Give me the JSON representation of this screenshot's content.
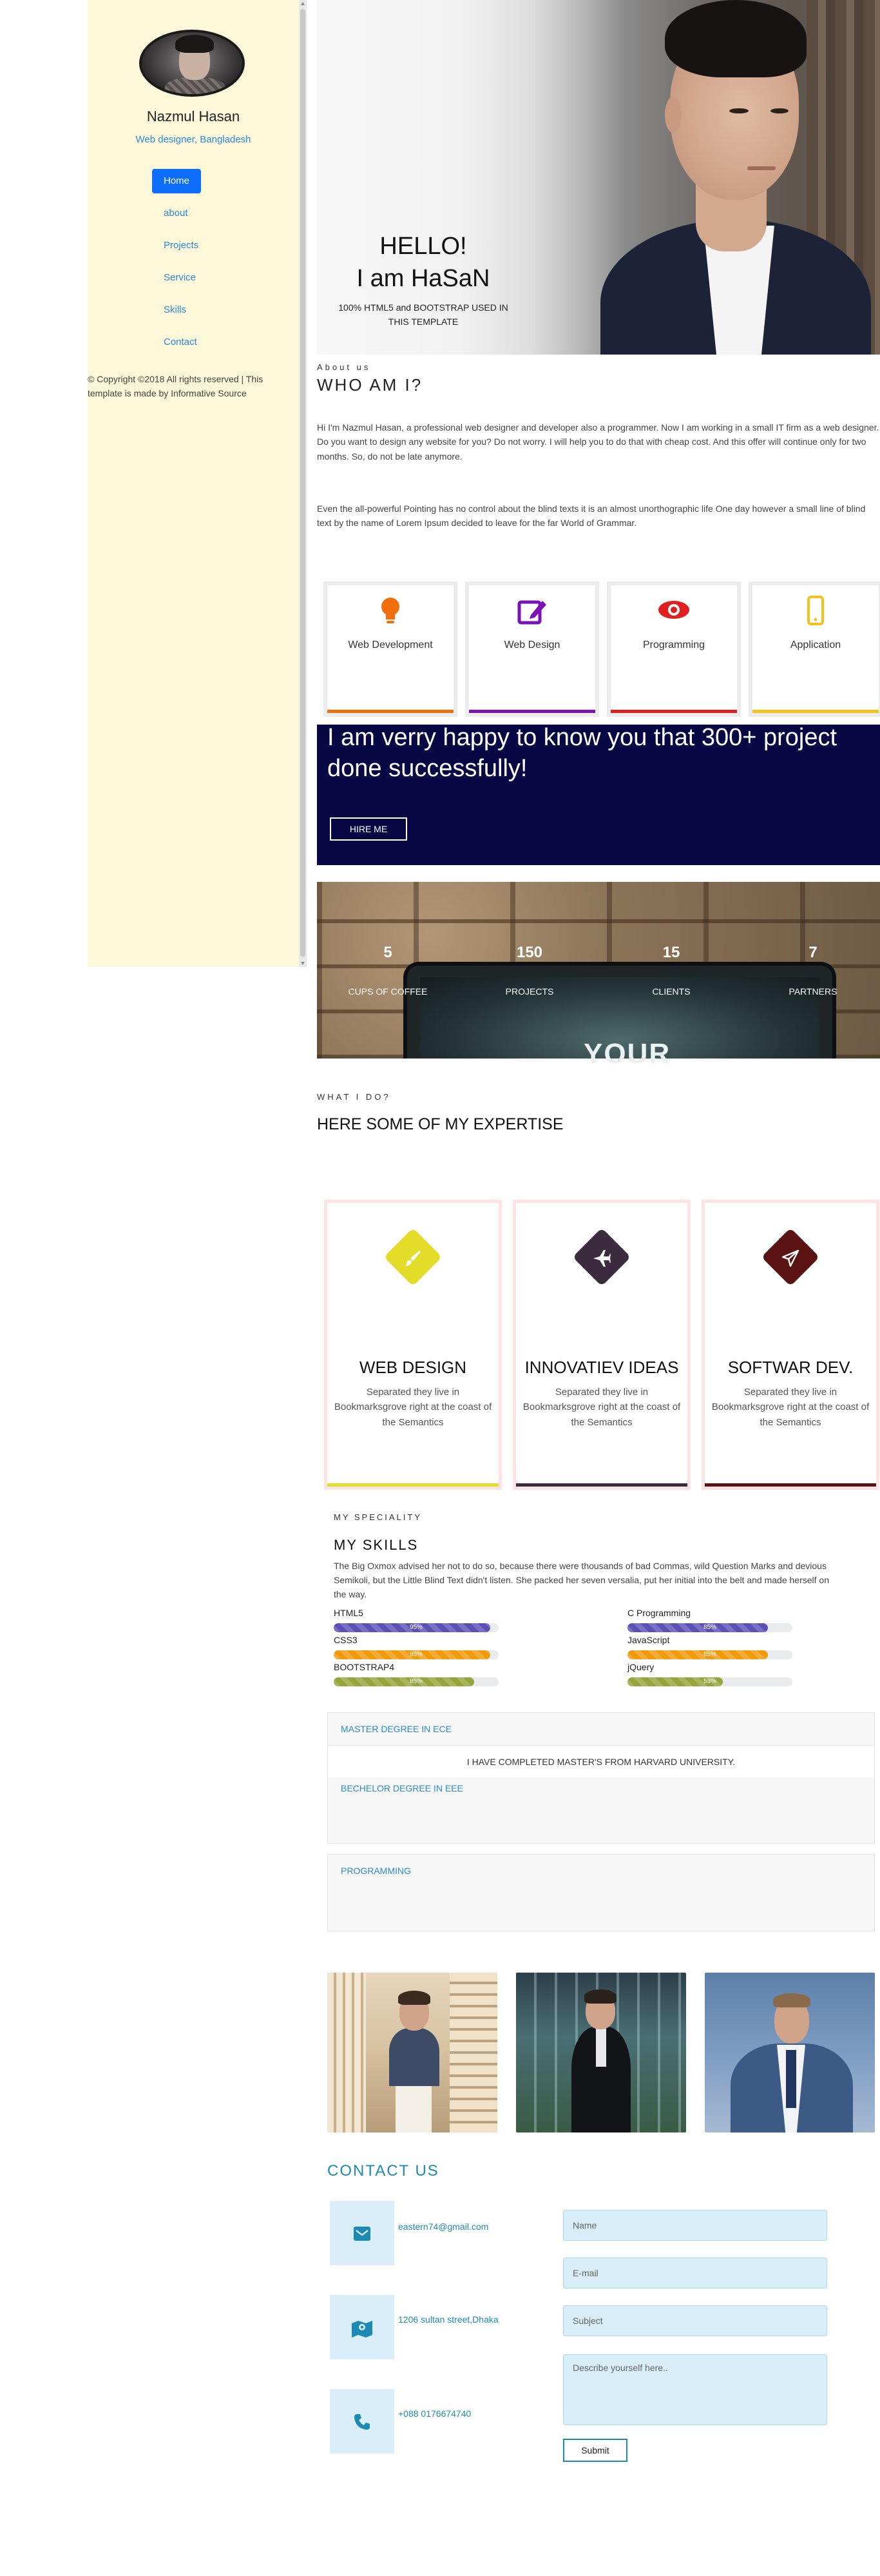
{
  "sidebar": {
    "name": "Nazmul Hasan",
    "role": "Web designer, Bangladesh",
    "home_label": "Home",
    "links": [
      "about",
      "Projects",
      "Service",
      "Skills",
      "Contact"
    ],
    "copyright": "© Copyright ©2018 All rights reserved | This template is made by Informative Source"
  },
  "hero": {
    "hello": "HELLO!",
    "name": "I am HaSaN",
    "subtitle": "100% HTML5 and BOOTSTRAP USED IN THIS TEMPLATE"
  },
  "about": {
    "small": "About us",
    "title": "WHO AM I?",
    "p1": "Hi I'm Nazmul Hasan, a professional web designer and developer also a programmer. Now I am working in a small IT firm as a web designer. Do you want to design any website for you? Do not worry. I will help you to do that with cheap cost. And this offer will continue only for two months. So, do not be late anymore.",
    "p2": "Even the all-powerful Pointing has no control about the blind texts it is an almost unorthographic life One day however a small line of blind text by the name of Lorem Ipsum decided to leave for the far World of Grammar."
  },
  "services": [
    {
      "label": "Web Development",
      "icon": "lightbulb-icon",
      "color": "#f06f0c"
    },
    {
      "label": "Web Design",
      "icon": "edit-icon",
      "color": "#7b12b5"
    },
    {
      "label": "Programming",
      "icon": "eye-icon",
      "color": "#e0201f"
    },
    {
      "label": "Application",
      "icon": "mobile-icon",
      "color": "#f5c21a"
    }
  ],
  "banner": {
    "text": "I am verry happy to know you that 300+ project done successfully!",
    "button": "HIRE ME"
  },
  "counters": [
    {
      "value": "5",
      "label": "CUPS OF COFFEE"
    },
    {
      "value": "150",
      "label": "PROJECTS"
    },
    {
      "value": "15",
      "label": "CLIENTS"
    },
    {
      "value": "7",
      "label": "PARTNERS"
    }
  ],
  "counter_bg_text": "YOUR",
  "expertise": {
    "small": "WHAT I DO?",
    "title": "HERE SOME OF MY EXPERTISE",
    "cards": [
      {
        "title": "WEB DESIGN",
        "desc": "Separated they live in Bookmarksgrove right at the coast of the Semantics",
        "icon": "brush-icon",
        "color": "#e3dc28"
      },
      {
        "title": "INNOVATIEV IDEAS",
        "desc": "Separated they live in Bookmarksgrove right at the coast of the Semantics",
        "icon": "plane-icon",
        "color": "#3c2a3f"
      },
      {
        "title": "SOFTWAR DEV.",
        "desc": "Separated they live in Bookmarksgrove right at the coast of the Semantics",
        "icon": "paper-plane-icon",
        "color": "#5a1312"
      }
    ]
  },
  "skills": {
    "small": "MY SPECIALITY",
    "title": "MY SKILLS",
    "desc_line1": "The Big Oxmox advised her not to do so, because there were thousands of bad Commas, wild Question Marks and devious",
    "desc_line2": "Semikoli, but the Little Blind Text didn't listen. She packed her seven versalia, put her initial into the belt and made herself on",
    "desc_line3": "the way.",
    "items": [
      {
        "name": "HTML5",
        "percent": 95,
        "label": "95%",
        "color": "#5b51b4"
      },
      {
        "name": "C Programming",
        "percent": 85,
        "label": "85%",
        "color": "#5b51b4"
      },
      {
        "name": "CSS3",
        "percent": 95,
        "label": "95%",
        "color": "#f19a0c"
      },
      {
        "name": "JavaScript",
        "percent": 85,
        "label": "85%",
        "color": "#f19a0c"
      },
      {
        "name": "BOOTSTRAP4",
        "percent": 85,
        "label": "85%",
        "color": "#97a33c"
      },
      {
        "name": "jQuery",
        "percent": 58,
        "label": "58%",
        "color": "#97a33c"
      }
    ]
  },
  "accordion": {
    "item1_head": "MASTER DEGREE IN ECE",
    "item1_body": "I HAVE COMPLETED MASTER'S FROM HARVARD UNIVERSITY.",
    "item2_head": "BECHELOR DEGREE IN EEE",
    "item3_head": "PROGRAMMING"
  },
  "contact": {
    "title": "CONTACT US",
    "email": "eastern74@gmail.com",
    "address": "1206 sultan street,Dhaka",
    "phone": "+088 0176674740",
    "placeholders": {
      "name": "Name",
      "email": "E-mail",
      "subject": "Subject",
      "message": "Describe yourself here.."
    },
    "submit": "Submit"
  }
}
